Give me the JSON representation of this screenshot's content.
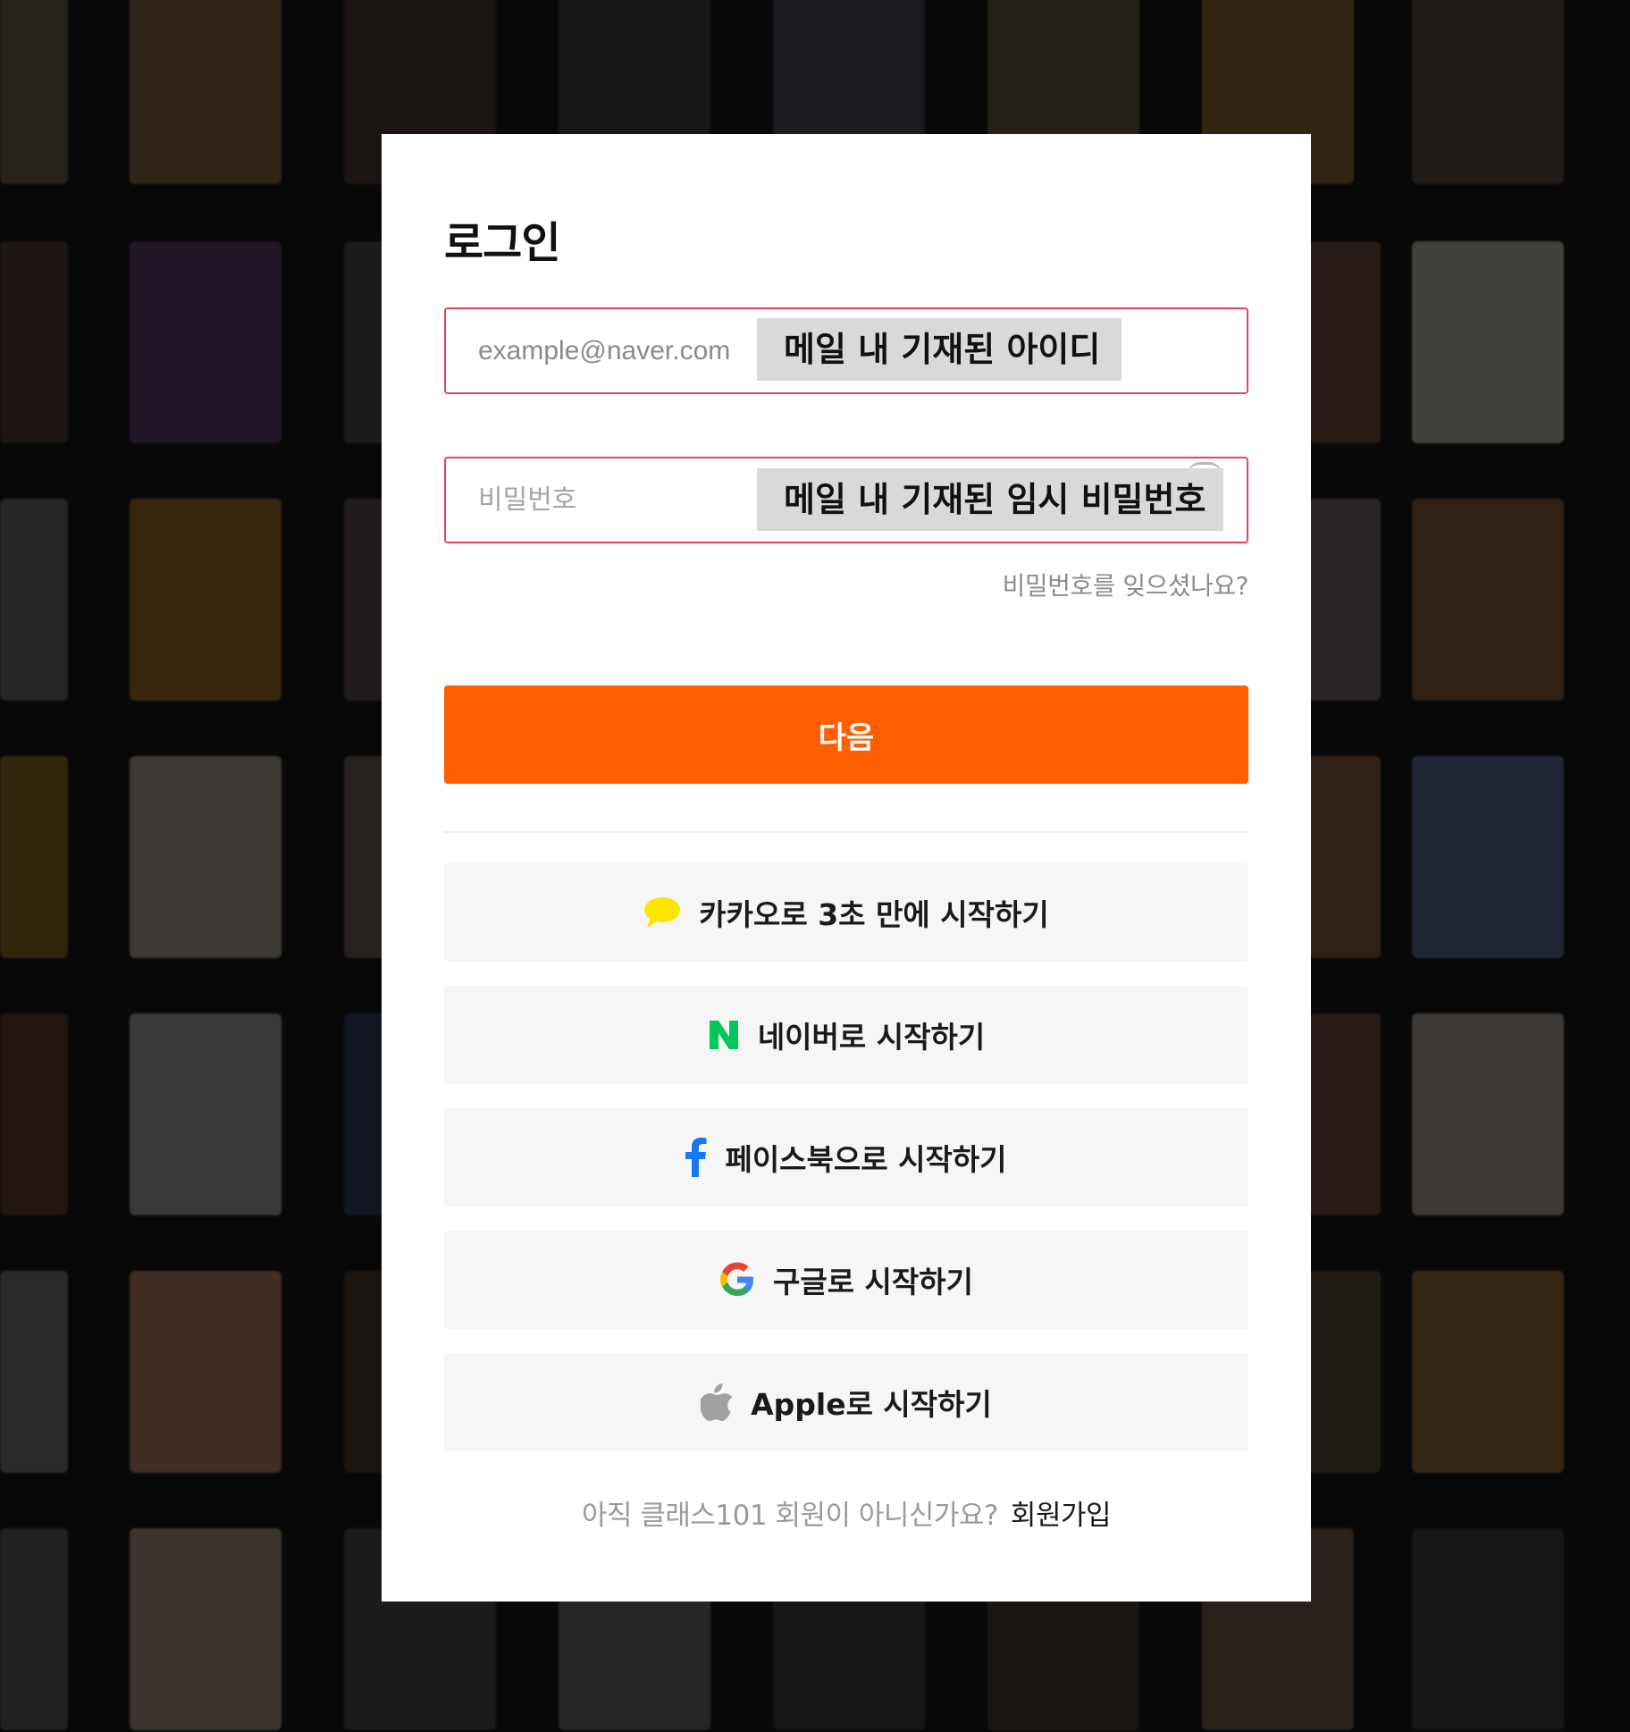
{
  "login": {
    "title": "로그인",
    "email": {
      "placeholder": "example@naver.com",
      "overlay_label": "메일 내 기재된 아이디"
    },
    "password": {
      "placeholder": "비밀번호",
      "overlay_label": "메일 내 기재된 임시 비밀번호"
    },
    "forgot_password": "비밀번호를 잊으셨나요?",
    "next_button": "다음",
    "social": [
      {
        "label": "카카오로 3초 만에 시작하기",
        "icon": "kakao-speech-bubble-icon",
        "color": "#fee500"
      },
      {
        "label": "네이버로 시작하기",
        "icon": "naver-n-icon",
        "color": "#03c75a"
      },
      {
        "label": "페이스북으로 시작하기",
        "icon": "facebook-f-icon",
        "color": "#1877f2"
      },
      {
        "label": "구글로 시작하기",
        "icon": "google-g-icon",
        "color": "#4285f4"
      },
      {
        "label": "Apple로 시작하기",
        "icon": "apple-logo-icon",
        "color": "#a0a0a0"
      }
    ],
    "signup_prompt": "아직 클래스101 회원이 아니신가요?",
    "signup_link": "회원가입"
  },
  "theme": {
    "accent": "#ff5f00",
    "error_border": "#e3455d",
    "background": "#0b0b0b"
  }
}
